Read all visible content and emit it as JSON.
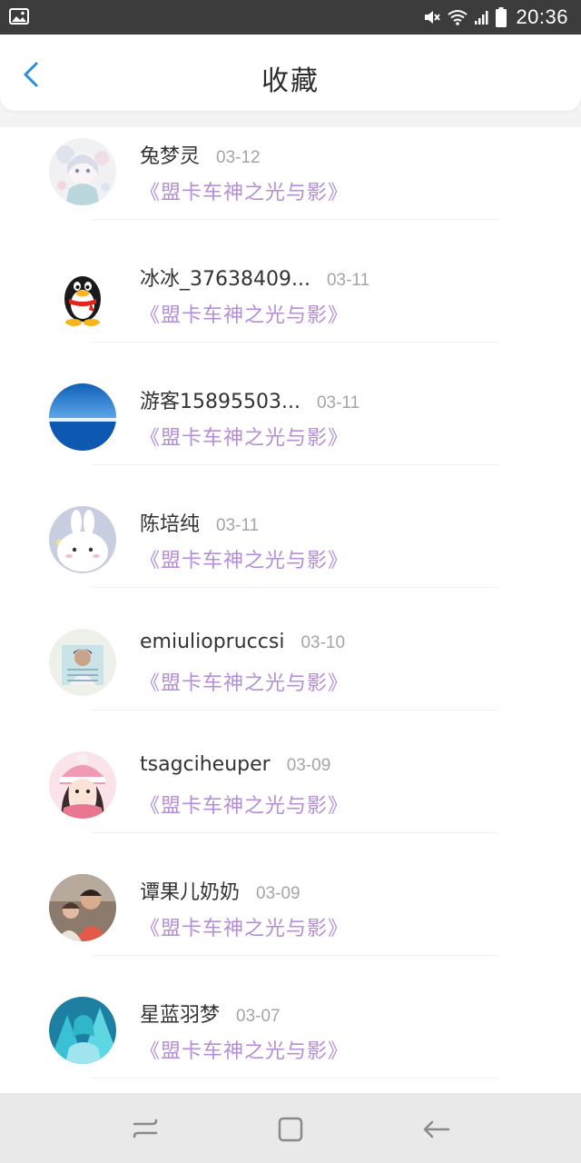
{
  "status_bar": {
    "time": "20:36",
    "icons": [
      "gallery-icon",
      "mute-icon",
      "wifi-icon",
      "signal-icon",
      "battery-icon"
    ]
  },
  "header": {
    "title": "收藏",
    "back_icon": "chevron-left-icon",
    "accent_color": "#2a8de0"
  },
  "favorites": [
    {
      "user": "兔梦灵",
      "date": "03-12",
      "book": "《盟卡车神之光与影》",
      "avatar": "anime-girl"
    },
    {
      "user": "冰冰_37638409...",
      "date": "03-11",
      "book": "《盟卡车神之光与影》",
      "avatar": "penguin"
    },
    {
      "user": "游客15895503...",
      "date": "03-11",
      "book": "《盟卡车神之光与影》",
      "avatar": "blue-landscape"
    },
    {
      "user": "陈培纯",
      "date": "03-11",
      "book": "《盟卡车神之光与影》",
      "avatar": "white-bunny"
    },
    {
      "user": "emiuliopruccsi",
      "date": "03-10",
      "book": "《盟卡车神之光与影》",
      "avatar": "boy-photo"
    },
    {
      "user": "tsagciheuper",
      "date": "03-09",
      "book": "《盟卡车神之光与影》",
      "avatar": "girl-pink-hat"
    },
    {
      "user": "谭果儿奶奶",
      "date": "03-09",
      "book": "《盟卡车神之光与影》",
      "avatar": "family-photo"
    },
    {
      "user": "星蓝羽梦",
      "date": "03-07",
      "book": "《盟卡车神之光与影》",
      "avatar": "miku-cyan"
    }
  ],
  "colors": {
    "book_title": "#b58ed8",
    "date": "#a5a5a5",
    "name": "#333333"
  },
  "nav_bar": {
    "buttons": [
      "recent-apps-icon",
      "home-icon",
      "back-icon"
    ]
  }
}
